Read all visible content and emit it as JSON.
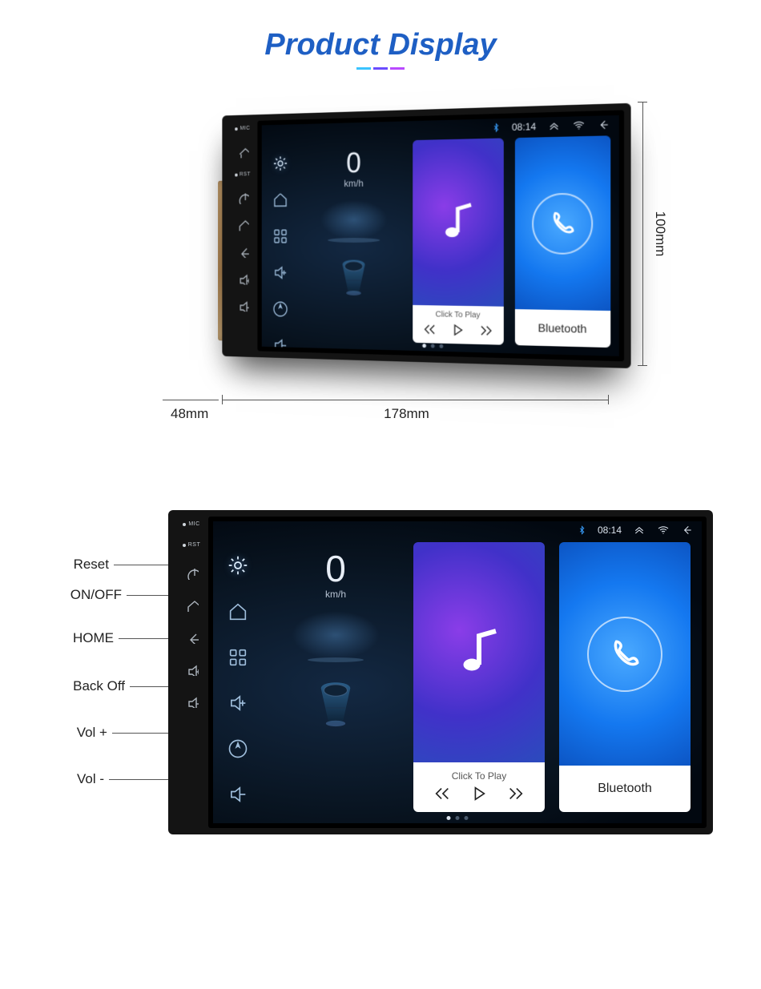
{
  "header": {
    "title": "Product Display"
  },
  "dimensions": {
    "height": "100mm",
    "width": "178mm",
    "depth": "48mm"
  },
  "device": {
    "mic_label": "MIC",
    "rst_label": "RST",
    "status": {
      "time": "08:14"
    },
    "speed": {
      "value": "0",
      "unit": "km/h"
    },
    "music_tile": {
      "caption": "Click To Play"
    },
    "bt_tile": {
      "label": "Bluetooth"
    }
  },
  "callouts": {
    "reset": "Reset",
    "onoff": "ON/OFF",
    "home": "HOME",
    "backoff": "Back Off",
    "volup": "Vol +",
    "voldown": "Vol -"
  },
  "icons": {
    "house": "home-icon",
    "power": "power-icon",
    "back": "back-icon",
    "volup": "volume-up-icon",
    "voldn": "volume-down-icon",
    "gear": "gear-icon",
    "grid": "apps-icon",
    "nav": "navigation-icon",
    "bt": "bluetooth-icon",
    "wifi": "wifi-icon",
    "note": "music-note-icon",
    "phone": "phone-icon",
    "prev": "previous-icon",
    "play": "play-icon",
    "next": "next-icon",
    "chev": "chevron-up-icon",
    "home_sb": "home-outline-icon"
  }
}
